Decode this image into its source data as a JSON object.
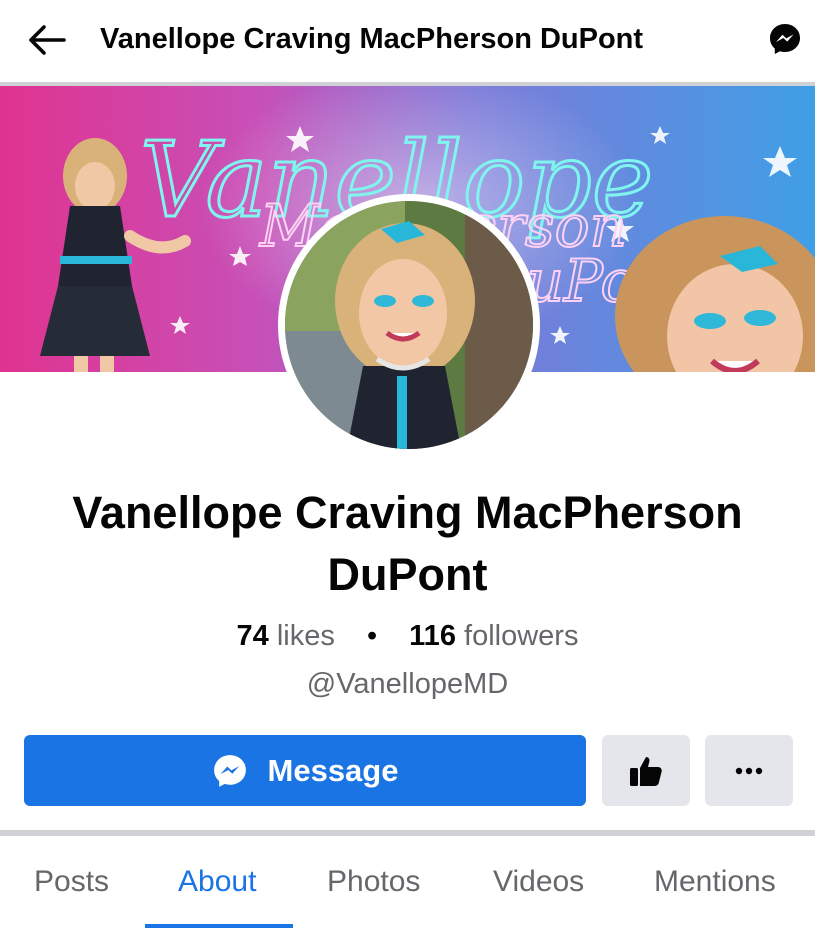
{
  "header": {
    "title": "Vanellope Craving MacPherson DuPont",
    "back_icon": "arrow-left-icon",
    "messenger_icon": "messenger-icon"
  },
  "cover": {
    "script_line1": "Vanellope",
    "script_line2": "MacPherson",
    "script_line3": "DuPont"
  },
  "profile": {
    "name": "Vanellope Craving MacPherson DuPont",
    "likes_count": "74",
    "likes_label": "likes",
    "dot": "•",
    "followers_count": "116",
    "followers_label": "followers",
    "handle": "@VanellopeMD"
  },
  "actions": {
    "message_label": "Message",
    "like_icon": "thumbs-up-icon",
    "more_icon": "more-dots-icon"
  },
  "tabs": [
    {
      "label": "Posts",
      "active": false
    },
    {
      "label": "About",
      "active": true
    },
    {
      "label": "Photos",
      "active": false
    },
    {
      "label": "Videos",
      "active": false
    },
    {
      "label": "Mentions",
      "active": false
    }
  ],
  "colors": {
    "accent": "#1b74e4",
    "button_gray": "#e4e6eb",
    "secondary_text": "#65676b"
  }
}
